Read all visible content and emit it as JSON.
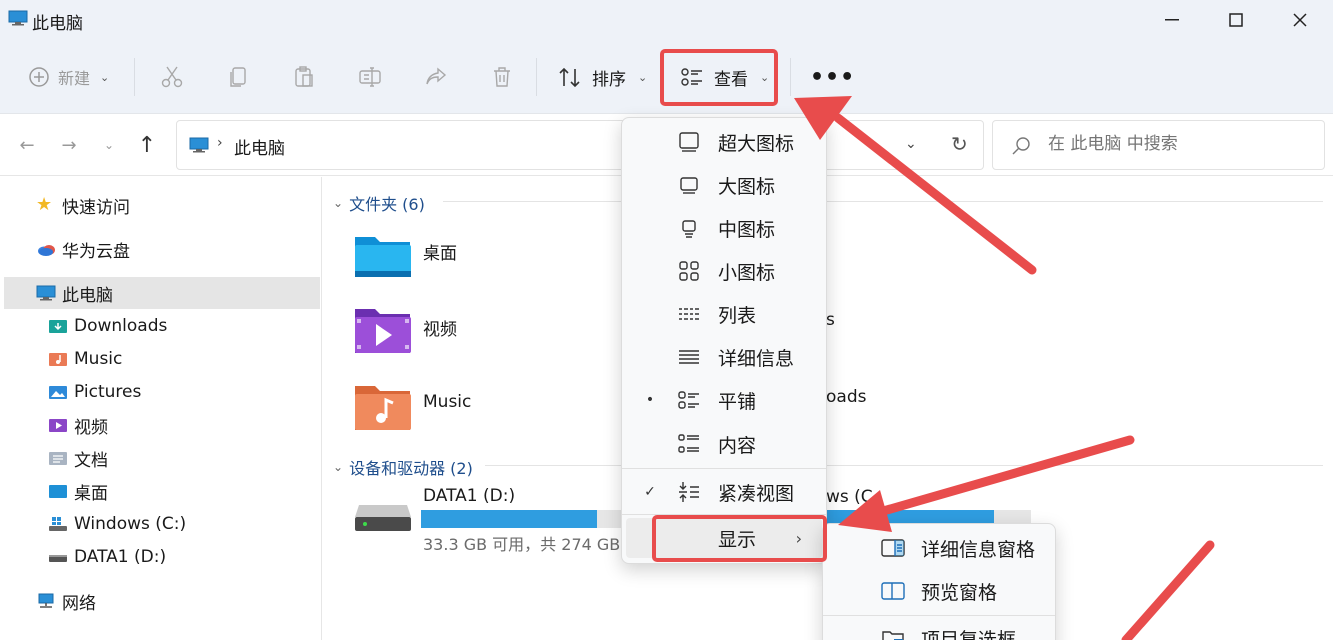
{
  "window": {
    "title": "此电脑"
  },
  "toolbar": {
    "new_label": "新建",
    "sort_label": "排序",
    "view_label": "查看",
    "more_label": "•••"
  },
  "address": {
    "crumb": "此电脑",
    "search_placeholder": "在 此电脑 中搜索"
  },
  "sidebar": {
    "items": [
      {
        "label": "快速访问",
        "icon": "star-icon"
      },
      {
        "label": "华为云盘",
        "icon": "cloud-icon"
      },
      {
        "label": "此电脑",
        "icon": "computer-icon"
      },
      {
        "label": "Downloads",
        "icon": "downloads-folder-icon"
      },
      {
        "label": "Music",
        "icon": "music-folder-icon"
      },
      {
        "label": "Pictures",
        "icon": "pictures-folder-icon"
      },
      {
        "label": "视频",
        "icon": "videos-folder-icon"
      },
      {
        "label": "文档",
        "icon": "documents-folder-icon"
      },
      {
        "label": "桌面",
        "icon": "desktop-folder-icon"
      },
      {
        "label": "Windows (C:)",
        "icon": "windows-drive-icon"
      },
      {
        "label": "DATA1 (D:)",
        "icon": "drive-icon"
      },
      {
        "label": "网络",
        "icon": "network-icon"
      }
    ]
  },
  "main": {
    "folders_header": "文件夹 (6)",
    "folders": [
      {
        "label": "桌面"
      },
      {
        "label": "视频"
      },
      {
        "label": "Music"
      }
    ],
    "partial_labels": [
      "s",
      "oads",
      "ws (C"
    ],
    "devices_header": "设备和驱动器 (2)",
    "drive": {
      "label": "DATA1 (D:)",
      "info": "33.3 GB 可用，共 274 GB",
      "used_fraction": 0.88
    }
  },
  "view_menu": {
    "items": [
      {
        "label": "超大图标",
        "mark": ""
      },
      {
        "label": "大图标",
        "mark": ""
      },
      {
        "label": "中图标",
        "mark": ""
      },
      {
        "label": "小图标",
        "mark": ""
      },
      {
        "label": "列表",
        "mark": ""
      },
      {
        "label": "详细信息",
        "mark": ""
      },
      {
        "label": "平铺",
        "mark": "•"
      },
      {
        "label": "内容",
        "mark": ""
      },
      {
        "label": "紧凑视图",
        "mark": "✓"
      },
      {
        "label": "显示",
        "mark": ""
      }
    ]
  },
  "show_submenu": {
    "items": [
      {
        "label": "详细信息窗格"
      },
      {
        "label": "预览窗格"
      },
      {
        "label": "项目复选框"
      }
    ]
  },
  "colors": {
    "accent": "#2f9de0",
    "highlight": "#e84c4c",
    "folder": "#1f4e8c"
  }
}
